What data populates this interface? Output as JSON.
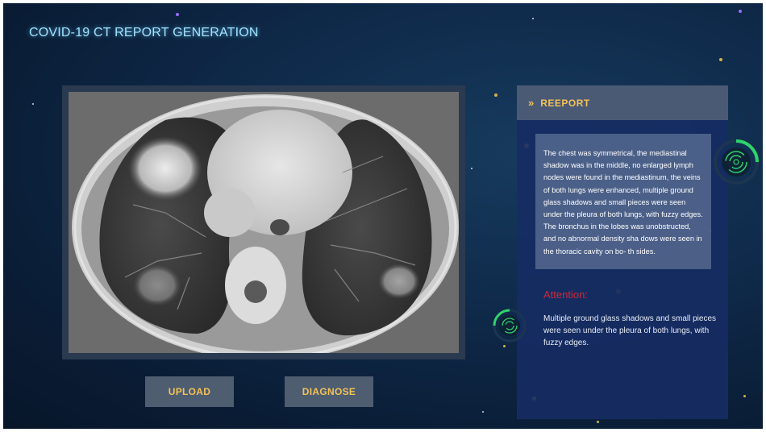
{
  "app": {
    "title": "COVID-19 CT REPORT GENERATION"
  },
  "ct_view": {
    "image_description_icon": "chest-ct-scan-image"
  },
  "actions": {
    "upload_label": "UPLOAD",
    "diagnose_label": "DIAGNOSE"
  },
  "report": {
    "header_icon": "double-chevron-right-icon",
    "title": "REEPORT",
    "findings": "The chest was symmetrical, the mediastinal shadow was in the middle, no enlarged lymph nodes were found in the mediastinum, the veins of both lungs were enhanced, multiple ground glass shadows and small pieces were seen under the pleura of both lungs, with fuzzy edges. The bronchus in the lobes was unobstructed, and no abnormal density sha dows were seen in the thoracic cavity on bo- th sides.",
    "attention_label": "Attention:",
    "attention_text": "Multiple ground glass shadows and small pieces were seen under the pleura of both lungs, with fuzzy edges."
  },
  "colors": {
    "title_glow": "#9fe3ff",
    "button_text": "#f2c25a",
    "attention": "#cc2a38",
    "ring_accent": "#2fd36a"
  }
}
